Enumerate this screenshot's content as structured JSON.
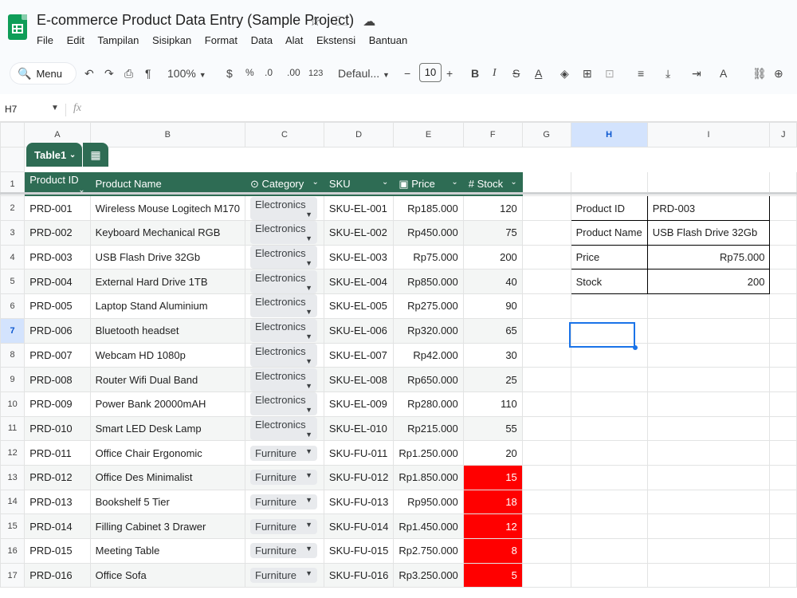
{
  "app": {
    "title": "E-commerce Product Data Entry (Sample Project)",
    "menu": [
      "File",
      "Edit",
      "Tampilan",
      "Sisipkan",
      "Format",
      "Data",
      "Alat",
      "Ekstensi",
      "Bantuan"
    ]
  },
  "toolbar": {
    "menu_label": "Menu",
    "zoom": "100%",
    "currency": "$",
    "percent": "%",
    "dec_decrease": ".0",
    "dec_increase": ".00",
    "number_format": "123",
    "font": "Defaul...",
    "font_size": "10"
  },
  "formula_bar": {
    "name_box": "H7",
    "fx": "fx"
  },
  "columns": [
    "A",
    "B",
    "C",
    "D",
    "E",
    "F",
    "G",
    "H",
    "I",
    "J"
  ],
  "table": {
    "name": "Table1",
    "headers": [
      "Product ID",
      "Product Name",
      "Category",
      "SKU",
      "Price",
      "Stock"
    ],
    "rows": [
      [
        "PRD-001",
        "Wireless Mouse Logitech M170",
        "Electronics",
        "SKU-EL-001",
        "Rp185.000",
        "120"
      ],
      [
        "PRD-002",
        "Keyboard Mechanical RGB",
        "Electronics",
        "SKU-EL-002",
        "Rp450.000",
        "75"
      ],
      [
        "PRD-003",
        "USB Flash Drive 32Gb",
        "Electronics",
        "SKU-EL-003",
        "Rp75.000",
        "200"
      ],
      [
        "PRD-004",
        "External Hard Drive 1TB",
        "Electronics",
        "SKU-EL-004",
        "Rp850.000",
        "40"
      ],
      [
        "PRD-005",
        "Laptop Stand Aluminium",
        "Electronics",
        "SKU-EL-005",
        "Rp275.000",
        "90"
      ],
      [
        "PRD-006",
        "Bluetooth headset",
        "Electronics",
        "SKU-EL-006",
        "Rp320.000",
        "65"
      ],
      [
        "PRD-007",
        "Webcam HD 1080p",
        "Electronics",
        "SKU-EL-007",
        "Rp42.000",
        "30"
      ],
      [
        "PRD-008",
        "Router Wifi Dual Band",
        "Electronics",
        "SKU-EL-008",
        "Rp650.000",
        "25"
      ],
      [
        "PRD-009",
        "Power Bank 20000mAH",
        "Electronics",
        "SKU-EL-009",
        "Rp280.000",
        "110"
      ],
      [
        "PRD-010",
        "Smart LED Desk Lamp",
        "Electronics",
        "SKU-EL-010",
        "Rp215.000",
        "55"
      ],
      [
        "PRD-011",
        "Office Chair Ergonomic",
        "Furniture",
        "SKU-FU-011",
        "Rp1.250.000",
        "20"
      ],
      [
        "PRD-012",
        "Office Des Minimalist",
        "Furniture",
        "SKU-FU-012",
        "Rp1.850.000",
        "15"
      ],
      [
        "PRD-013",
        "Bookshelf 5 Tier",
        "Furniture",
        "SKU-FU-013",
        "Rp950.000",
        "18"
      ],
      [
        "PRD-014",
        "Filling Cabinet 3 Drawer",
        "Furniture",
        "SKU-FU-014",
        "Rp1.450.000",
        "12"
      ],
      [
        "PRD-015",
        "Meeting Table",
        "Furniture",
        "SKU-FU-015",
        "Rp2.750.000",
        "8"
      ],
      [
        "PRD-016",
        "Office Sofa",
        "Furniture",
        "SKU-FU-016",
        "Rp3.250.000",
        "5"
      ]
    ],
    "low_stock_color": "#ff0000",
    "header_color": "#2e6c54"
  },
  "lookup": {
    "rows": [
      [
        "Product ID",
        "PRD-003"
      ],
      [
        "Product Name",
        "USB Flash Drive 32Gb"
      ],
      [
        "Price",
        "Rp75.000"
      ],
      [
        "Stock",
        "200"
      ]
    ]
  }
}
